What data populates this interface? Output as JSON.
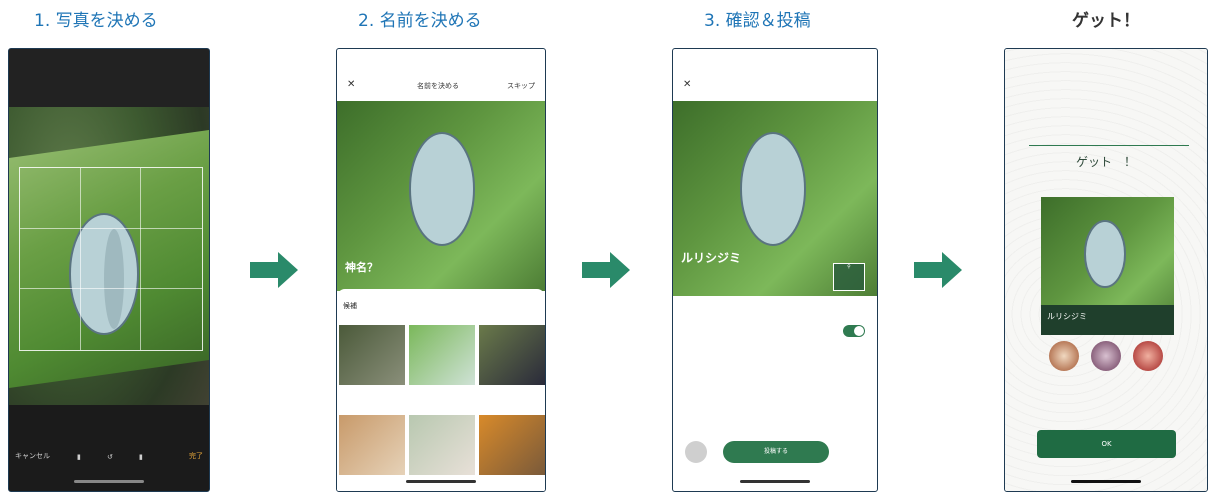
{
  "steps": [
    {
      "title": "1. 写真を決める"
    },
    {
      "title": "2. 名前を決める"
    },
    {
      "title": "3. 確認＆投稿"
    },
    {
      "title": "ゲット！"
    }
  ],
  "phone2": {
    "header_title": "名前を決める",
    "skip": "スキップ",
    "hero_name": "神名？",
    "sheet_title": "候補",
    "cells": [
      "",
      "",
      "",
      "",
      "",
      ""
    ]
  },
  "phone3": {
    "hero_name": "ルリシジミ",
    "post_label": "投稿する"
  },
  "phone4": {
    "title": "ゲット　！",
    "card_name": "ルリシジミ",
    "ok_label": "OK"
  },
  "colors": {
    "step_title": "#1f75b6",
    "arrow": "#2a8a6a",
    "primary_green": "#2f7a50"
  }
}
